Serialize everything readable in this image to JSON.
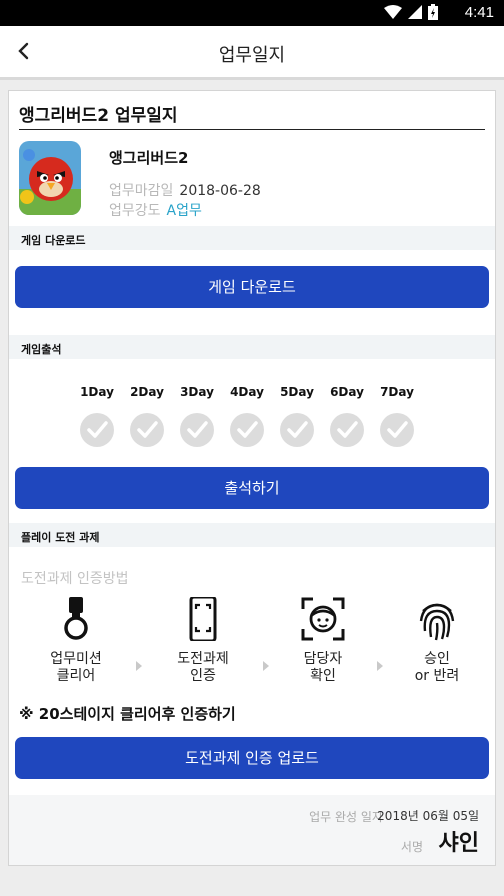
{
  "status_bar": {
    "time": "4:41"
  },
  "app_bar": {
    "title": "업무일지"
  },
  "card": {
    "title": "앵그리버드2 업무일지",
    "game_name": "앵그리버드2",
    "deadline_label": "업무마감일",
    "deadline_value": "2018-06-28",
    "intensity_label": "업무강도",
    "intensity_value": "A업무"
  },
  "download": {
    "section": "게임 다운로드",
    "button": "게임 다운로드"
  },
  "attendance": {
    "section": "게임출석",
    "days": [
      "1Day",
      "2Day",
      "3Day",
      "4Day",
      "5Day",
      "6Day",
      "7Day"
    ],
    "button": "출석하기"
  },
  "challenge": {
    "section": "플레이 도전 과제",
    "method_label": "도전과제 인증방법",
    "steps": [
      {
        "line1": "업무미션",
        "line2": "클리어"
      },
      {
        "line1": "도전과제",
        "line2": "인증"
      },
      {
        "line1": "담당자",
        "line2": "확인"
      },
      {
        "line1": "승인",
        "line2": "or 반려"
      }
    ],
    "note": "※ 20스테이지 클리어후 인증하기",
    "button": "도전과제 인증 업로드"
  },
  "footer": {
    "done_label": "업무 완성 일자",
    "done_value": "2018년 06월 05일",
    "sign_label": "서명",
    "sign_value": "샤인"
  },
  "colors": {
    "primary": "#1f47be",
    "accent": "#2aa3c9",
    "check_bg": "#dcdcdc"
  }
}
